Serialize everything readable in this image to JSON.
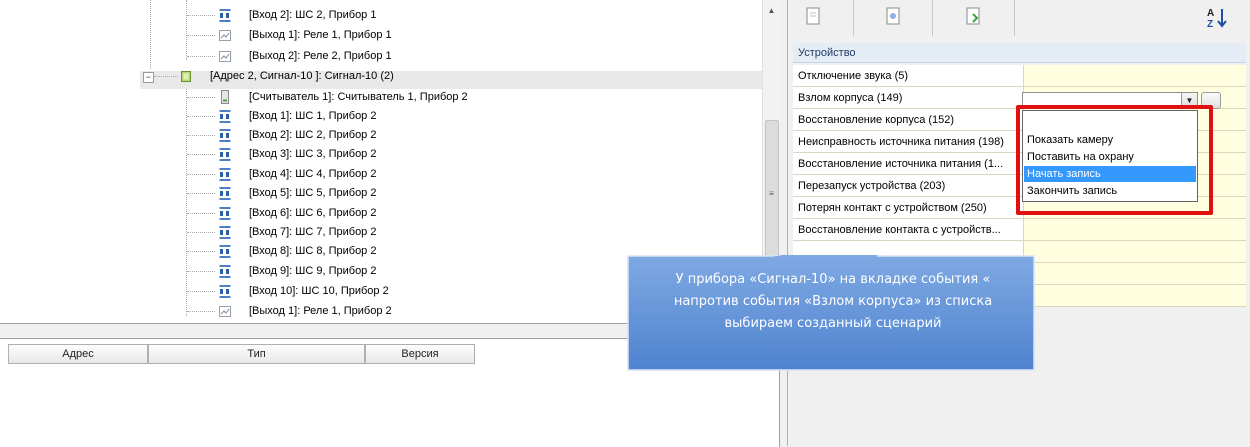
{
  "tree": {
    "rows": [
      {
        "icon": "ai-input-icon",
        "label": "[Вход 2]: ШС 2, Прибор 1"
      },
      {
        "icon": "relay-output-icon",
        "label": "[Выход 1]: Реле 1, Прибор 1"
      },
      {
        "icon": "relay-output-icon",
        "label": "[Выход 2]: Реле 2, Прибор 1"
      },
      {
        "icon": "device-icon",
        "label": "[Адрес 2, Сигнал-10 ]: Сигнал-10 (2)"
      },
      {
        "icon": "reader-icon",
        "label": "[Считыватель 1]: Считыватель 1, Прибор 2"
      },
      {
        "icon": "ai-input-icon",
        "label": "[Вход 1]: ШС 1, Прибор 2"
      },
      {
        "icon": "ai-input-icon",
        "label": "[Вход 2]: ШС 2, Прибор 2"
      },
      {
        "icon": "ai-input-icon",
        "label": "[Вход 3]: ШС 3, Прибор 2"
      },
      {
        "icon": "ai-input-icon",
        "label": "[Вход 4]: ШС 4, Прибор 2"
      },
      {
        "icon": "ai-input-icon",
        "label": "[Вход 5]: ШС 5, Прибор 2"
      },
      {
        "icon": "ai-input-icon",
        "label": "[Вход 6]: ШС 6, Прибор 2"
      },
      {
        "icon": "ai-input-icon",
        "label": "[Вход 7]: ШС 7, Прибор 2"
      },
      {
        "icon": "ai-input-icon",
        "label": "[Вход 8]: ШС 8, Прибор 2"
      },
      {
        "icon": "ai-input-icon",
        "label": "[Вход 9]: ШС 9, Прибор 2"
      },
      {
        "icon": "ai-input-icon",
        "label": "[Вход 10]: ШС 10, Прибор 2"
      },
      {
        "icon": "relay-output-icon",
        "label": "[Выход 1]: Реле 1, Прибор 2"
      }
    ]
  },
  "device_table": {
    "columns": [
      "Адрес",
      "Тип",
      "Версия"
    ]
  },
  "properties": {
    "toolbar": [
      "events-tab-icon",
      "settings-tab-icon",
      "export-tab-icon",
      "sort-az-icon"
    ],
    "category": "Устройство",
    "rows": [
      {
        "name": "Отключение звука (5)",
        "value": ""
      },
      {
        "name": "Взлом корпуса (149)",
        "value": ""
      },
      {
        "name": "Восстановление корпуса (152)",
        "value": ""
      },
      {
        "name": "Неисправность источника питания (198)",
        "value": ""
      },
      {
        "name": "Восстановление источника питания (1...",
        "value": ""
      },
      {
        "name": "Перезапуск устройства (203)",
        "value": ""
      },
      {
        "name": "Потерян контакт с устройством (250)",
        "value": ""
      },
      {
        "name": "Восстановление контакта с устройств...",
        "value": ""
      },
      {
        "name": "",
        "value": ""
      },
      {
        "name": "",
        "value": ""
      },
      {
        "name": "",
        "value": ""
      }
    ],
    "combo_value": "",
    "dropdown_options": [
      "Показать камеру",
      "Поставить на охрану",
      "Начать запись",
      "Закончить запись"
    ],
    "highlighted_option": "Начать запись"
  },
  "callout": {
    "line1": "У прибора «Сигнал-10» на вкладке события «",
    "line2": "напротив события  «Взлом корпуса» из списка",
    "line3": "выбираем созданный сценарий"
  },
  "colors": {
    "highlight": "#3399ff",
    "redbox": "#e01010",
    "callout": "#5b8fd6",
    "grid_value_bg": "#ffffe0"
  }
}
